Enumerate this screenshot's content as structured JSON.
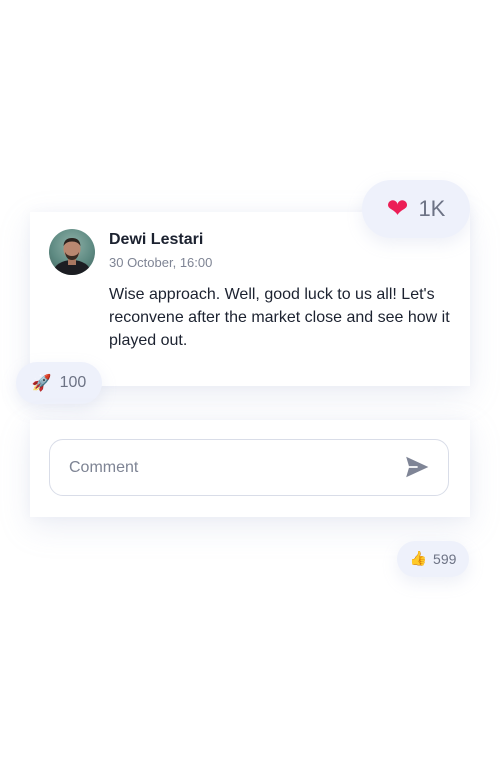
{
  "post": {
    "author": "Dewi Lestari",
    "timestamp": "30 October, 16:00",
    "text": "Wise approach. Well, good luck to us all! Let's reconvene after the market close and see how it played out."
  },
  "reactions": {
    "heart": {
      "icon": "heart-icon",
      "emoji": "❤",
      "count": "1K",
      "color": "#ec1e56"
    },
    "rocket": {
      "icon": "rocket-icon",
      "emoji": "🚀",
      "count": "100"
    },
    "thumbs_up": {
      "icon": "thumbs-up-icon",
      "emoji": "👍",
      "count": "599"
    }
  },
  "comment": {
    "placeholder": "Comment",
    "send_icon": "send-icon"
  },
  "colors": {
    "pill_background": "#eef1fb",
    "text_primary": "#1c2230",
    "text_secondary": "#7e8494",
    "send_icon": "#7f8596"
  }
}
